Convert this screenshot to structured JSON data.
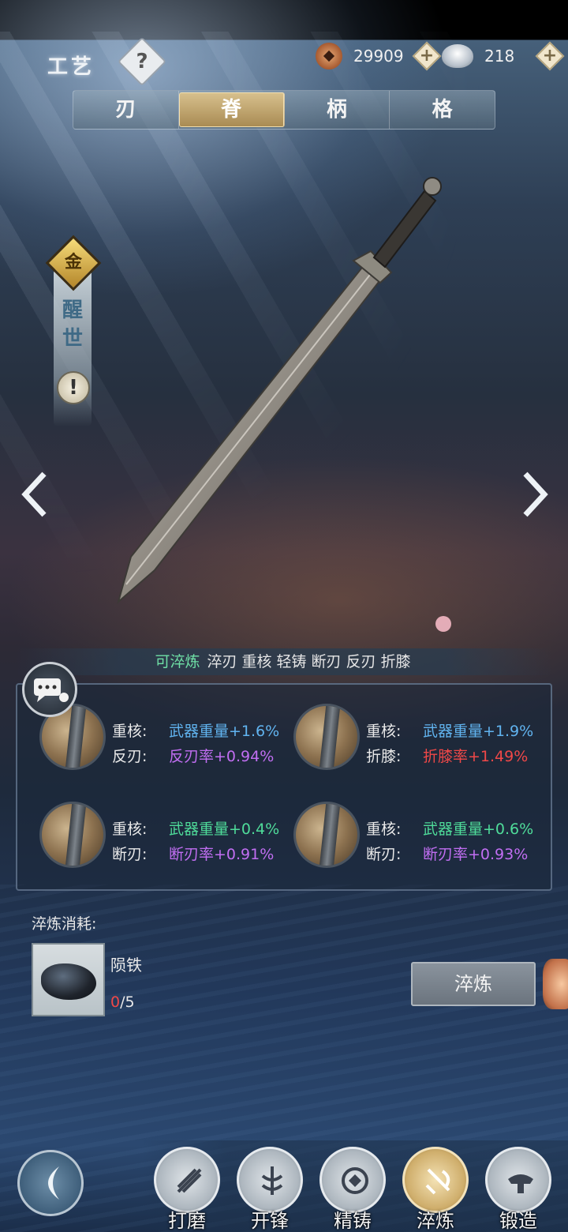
{
  "header": {
    "title": "工艺",
    "help_label": "?",
    "currencies": [
      {
        "icon": "copper-coin-icon",
        "value": "29909"
      },
      {
        "icon": "silver-ingot-icon",
        "value": "218"
      }
    ],
    "plus_label": "+"
  },
  "tabs": [
    {
      "label": "刃",
      "active": false
    },
    {
      "label": "脊",
      "active": true
    },
    {
      "label": "柄",
      "active": false
    },
    {
      "label": "格",
      "active": false
    }
  ],
  "weapon": {
    "rank": "金",
    "name": "醒世",
    "info_label": "!"
  },
  "tags": {
    "status": "可淬炼",
    "items": [
      "淬刃",
      "重核",
      "轻铸",
      "断刃",
      "反刃",
      "折膝"
    ]
  },
  "stats": [
    {
      "row1_label": "重核:",
      "row1_value": "武器重量+1.6%",
      "row1_color": "#61b4f0",
      "row2_label": "反刃:",
      "row2_value": "反刃率+0.94%",
      "row2_color": "#c16ef2"
    },
    {
      "row1_label": "重核:",
      "row1_value": "武器重量+1.9%",
      "row1_color": "#61b4f0",
      "row2_label": "折膝:",
      "row2_value": "折膝率+1.49%",
      "row2_color": "#f04848"
    },
    {
      "row1_label": "重核:",
      "row1_value": "武器重量+0.4%",
      "row1_color": "#4fdc9a",
      "row2_label": "断刃:",
      "row2_value": "断刃率+0.91%",
      "row2_color": "#c16ef2"
    },
    {
      "row1_label": "重核:",
      "row1_value": "武器重量+0.6%",
      "row1_color": "#4fdc9a",
      "row2_label": "断刃:",
      "row2_value": "断刃率+0.93%",
      "row2_color": "#c16ef2"
    }
  ],
  "cost": {
    "title": "淬炼消耗:",
    "material_name": "陨铁",
    "have": "0",
    "need": "/5"
  },
  "temper_button": "淬炼",
  "nav": [
    {
      "label": "打磨",
      "icon": "grind-icon",
      "active": false
    },
    {
      "label": "开锋",
      "icon": "sharpen-icon",
      "active": false
    },
    {
      "label": "精铸",
      "icon": "refine-cast-icon",
      "active": false
    },
    {
      "label": "淬炼",
      "icon": "temper-icon",
      "active": true
    },
    {
      "label": "锻造",
      "icon": "forge-icon",
      "active": false
    }
  ]
}
